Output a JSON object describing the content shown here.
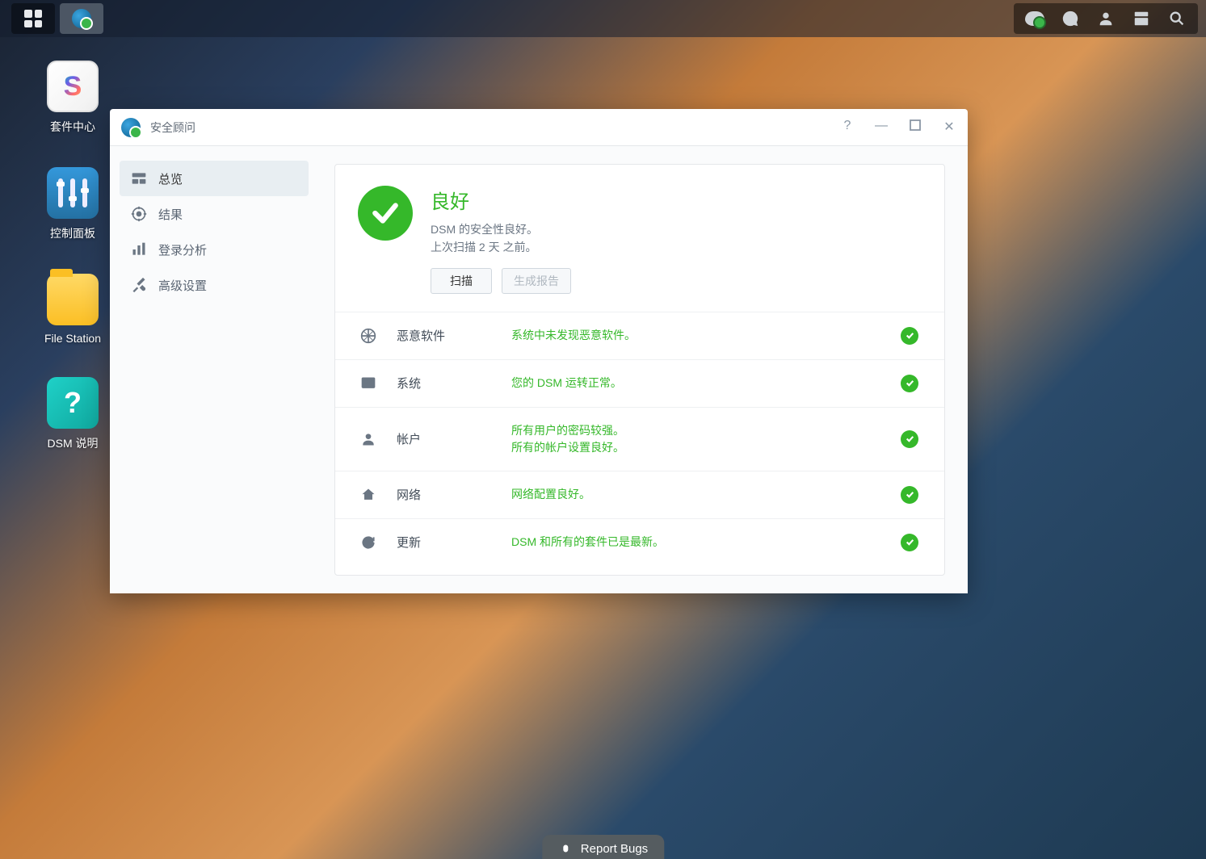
{
  "desktop_icons": {
    "package_center": "套件中心",
    "control_panel": "控制面板",
    "file_station": "File Station",
    "dsm_help": "DSM 说明"
  },
  "window": {
    "title": "安全顾问",
    "sidebar": {
      "overview": "总览",
      "results": "结果",
      "login_analysis": "登录分析",
      "advanced": "高级设置"
    },
    "status": {
      "title": "良好",
      "line1": "DSM 的安全性良好。",
      "line2": "上次扫描 2 天 之前。",
      "scan_btn": "扫描",
      "report_btn": "生成报告"
    },
    "categories": [
      {
        "name": "恶意软件",
        "msg": "系统中未发现恶意软件。"
      },
      {
        "name": "系统",
        "msg": "您的 DSM 运转正常。"
      },
      {
        "name": "帐户",
        "msg": "所有用户的密码较强。\n所有的帐户设置良好。"
      },
      {
        "name": "网络",
        "msg": "网络配置良好。"
      },
      {
        "name": "更新",
        "msg": "DSM 和所有的套件已是最新。"
      }
    ]
  },
  "report_bugs": "Report Bugs"
}
